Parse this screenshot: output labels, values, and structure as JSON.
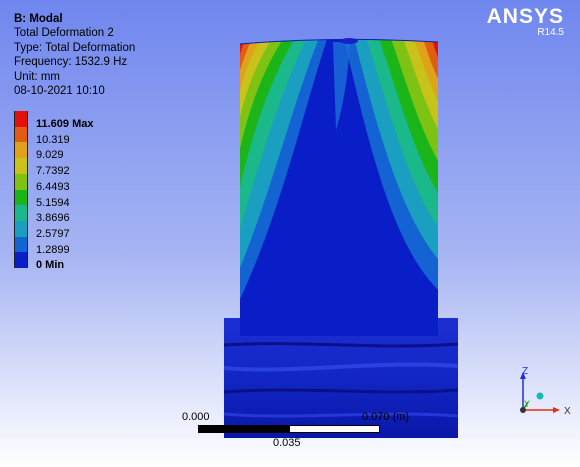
{
  "info": {
    "title": "B: Modal",
    "lines": [
      "Total Deformation 2",
      "Type: Total Deformation",
      "Frequency: 1532.9 Hz",
      "Unit: mm",
      "08-10-2021 10:10"
    ]
  },
  "legend": {
    "items": [
      {
        "label": "11.609 Max",
        "color": "#e3100c",
        "bold": true
      },
      {
        "label": "10.319",
        "color": "#e05d12"
      },
      {
        "label": "9.029",
        "color": "#e0a21b"
      },
      {
        "label": "7.7392",
        "color": "#c9c21a"
      },
      {
        "label": "6.4493",
        "color": "#7ec314"
      },
      {
        "label": "5.1594",
        "color": "#1bb51a"
      },
      {
        "label": "3.8696",
        "color": "#1ab88a"
      },
      {
        "label": "2.5797",
        "color": "#1a9fc0"
      },
      {
        "label": "1.2899",
        "color": "#1463d2"
      },
      {
        "label": "0 Min",
        "color": "#0a1ec8",
        "bold": true
      }
    ]
  },
  "brand": {
    "name": "ANSYS",
    "version": "R14.5"
  },
  "scale": {
    "left": "0.000",
    "right": "0.070 (m)",
    "mid": "0.035"
  },
  "triad": {
    "z": "Z",
    "y": "Y",
    "x": "X"
  }
}
